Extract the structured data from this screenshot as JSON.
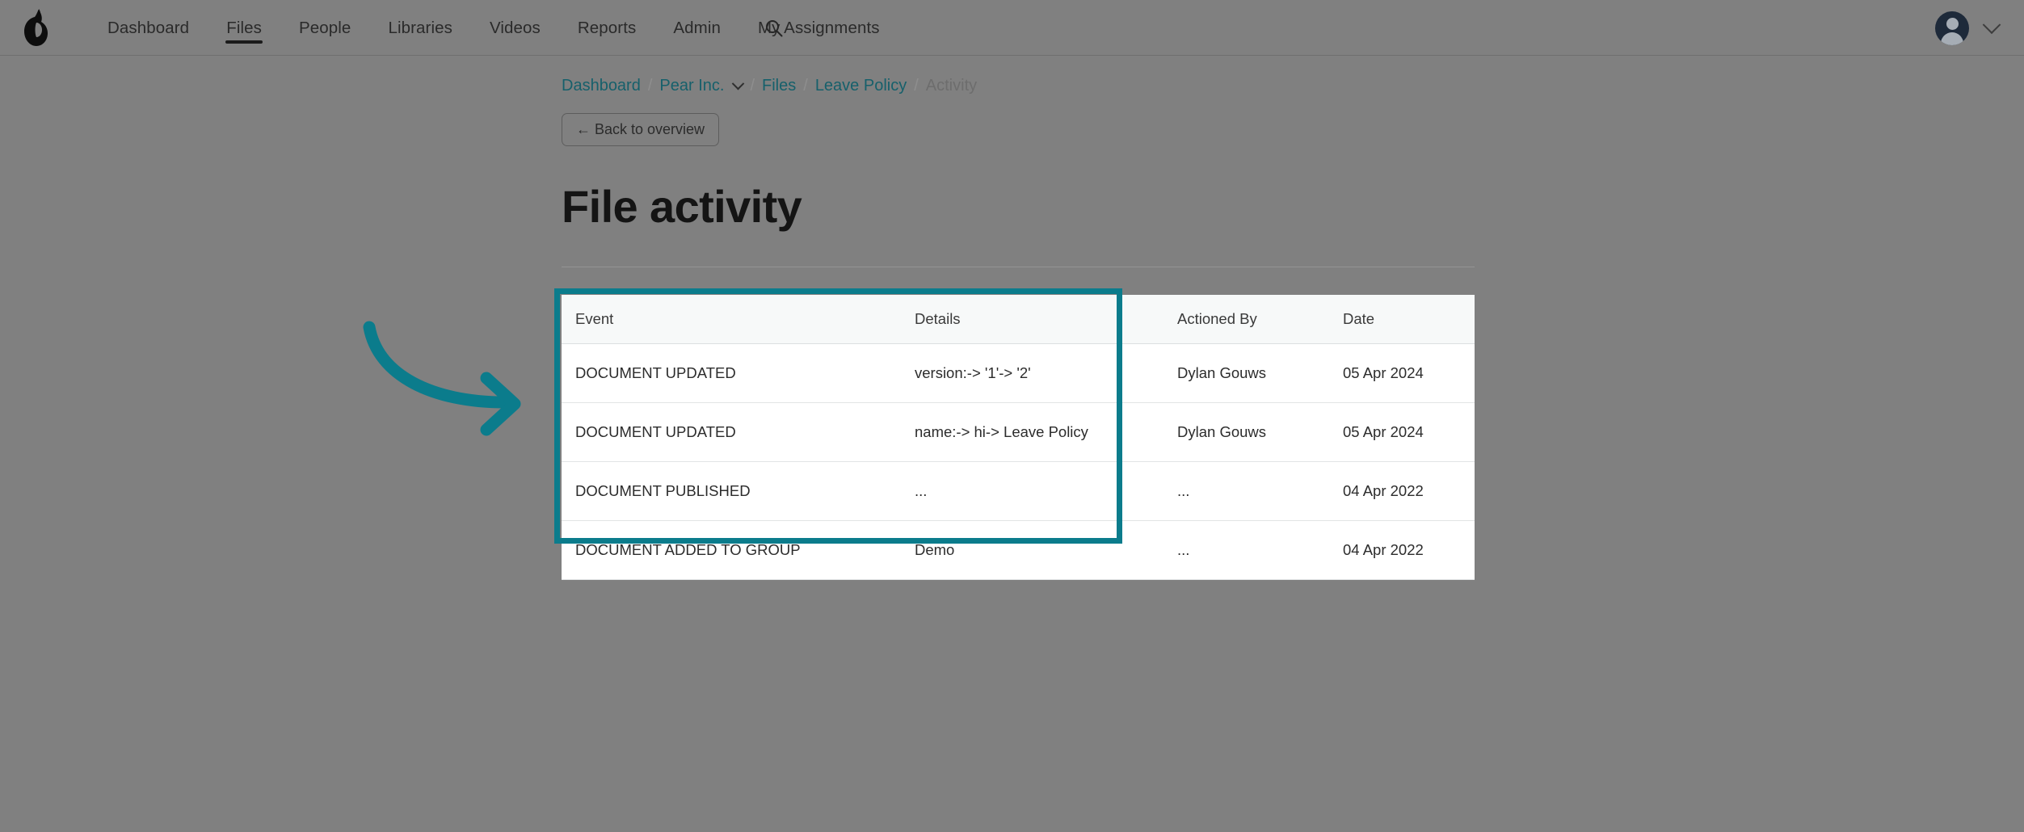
{
  "navbar": {
    "logo_icon": "pear-logo-icon",
    "items": [
      {
        "label": "Dashboard",
        "active": false
      },
      {
        "label": "Files",
        "active": true
      },
      {
        "label": "People",
        "active": false
      },
      {
        "label": "Libraries",
        "active": false
      },
      {
        "label": "Videos",
        "active": false
      },
      {
        "label": "Reports",
        "active": false
      },
      {
        "label": "Admin",
        "active": false
      },
      {
        "label": "My Assignments",
        "active": false
      }
    ],
    "search_icon": "search-icon",
    "avatar_icon": "user-avatar-icon",
    "account_chevron_icon": "chevron-down-icon"
  },
  "breadcrumb": {
    "dashboard": "Dashboard",
    "org": "Pear Inc.",
    "files": "Files",
    "file": "Leave Policy",
    "current": "Activity",
    "separator": "/",
    "org_chevron_icon": "chevron-down-icon"
  },
  "back_button": {
    "label": "← Back to overview"
  },
  "page": {
    "title": "File activity"
  },
  "table": {
    "columns": [
      "Event",
      "Details",
      "Actioned By",
      "Date"
    ],
    "rows": [
      {
        "event": "DOCUMENT UPDATED",
        "details": "version:-> '1'-> '2'",
        "actioned_by": "Dylan Gouws",
        "date": "05 Apr 2024"
      },
      {
        "event": "DOCUMENT UPDATED",
        "details": "name:-> hi-> Leave Policy",
        "actioned_by": "Dylan Gouws",
        "date": "05 Apr 2024"
      },
      {
        "event": "DOCUMENT PUBLISHED",
        "details": "...",
        "actioned_by": "...",
        "date": "04 Apr 2022"
      },
      {
        "event": "DOCUMENT ADDED TO GROUP",
        "details": "Demo",
        "actioned_by": "...",
        "date": "04 Apr 2022"
      }
    ]
  },
  "annotation": {
    "highlight_color": "#0b7c8c",
    "arrow_icon": "curved-arrow-right-icon"
  },
  "colors": {
    "accent_teal": "#0b7c8c",
    "link_teal": "#16606b",
    "page_background": "#808080"
  }
}
